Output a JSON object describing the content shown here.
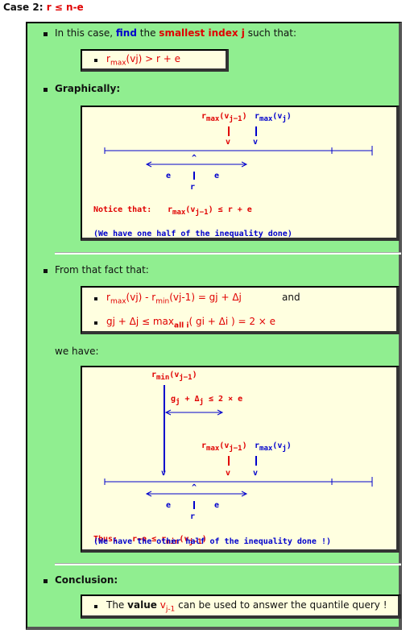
{
  "case_title": {
    "prefix": "Case 2:",
    "condition": "r ≤ n-e"
  },
  "section1": {
    "t1": "In this case,",
    "find": "find",
    "t2": "the",
    "smallest": "smallest index j",
    "t3": "such that:"
  },
  "formula1": {
    "r": "r",
    "max": "max",
    "arg": "(vj)",
    "rest": " > r + e"
  },
  "section2": {
    "title": "Graphically:"
  },
  "diagram1": {
    "rmax1": "r",
    "max1": "max",
    "arg1": "(v",
    "sub1": "j−1",
    "close1": ")",
    "rmax2": "r",
    "max2": "max",
    "arg2": "(v",
    "sub2": "j",
    "close2": ")",
    "v1": "v",
    "v2": "v",
    "e_left": "e",
    "e_right": "e",
    "r_label": "r",
    "caret": "^",
    "notice_label": "Notice that:",
    "notice_r": "r",
    "notice_max": "max",
    "notice_arg": "(v",
    "notice_sub": "j−1",
    "notice_rest": ") ≤ r + e",
    "half": "(We have one half of the inequality done)"
  },
  "section3": {
    "title": "From that fact that:"
  },
  "formula2": {
    "line1_r": "r",
    "line1_max": "max",
    "line1_arg": "(vj) - r",
    "line1_min": "min",
    "line1_arg2": "(vj-1) = gj + Δj",
    "and": "and",
    "line2_a": "gj + Δj ≤ max",
    "line2_sub": "all i",
    "line2_b": "( gi + Δi ) = 2 × e"
  },
  "we_have": "we have:",
  "diagram2": {
    "rmin": "r",
    "min": "min",
    "rmin_arg": "(v",
    "rmin_sub": "j−1",
    "rmin_close": ")",
    "gap": "g",
    "gap_sub": "j",
    "gap_plus": " + Δ",
    "gap_sub2": "j",
    "gap_rest": " ≤ 2 × e",
    "rmax1": "r",
    "max1": "max",
    "arg1": "(v",
    "sub1": "j−1",
    "close1": ")",
    "rmax2": "r",
    "max2": "max",
    "arg2": "(v",
    "sub2": "j",
    "close2": ")",
    "v0": "v",
    "v1": "v",
    "v2": "v",
    "e_left": "e",
    "e_right": "e",
    "r_label": "r",
    "caret": "^",
    "thus_label": "Thus:",
    "thus_expr": "r−e ≤ r",
    "thus_min": "min",
    "thus_arg": "(v",
    "thus_sub": "j−1",
    "thus_close": ")",
    "half": "(We have the other half of the inequality done !)"
  },
  "section4": {
    "title": "Conclusion:"
  },
  "conclusion": {
    "t1": "The",
    "value": "value",
    "v": "v",
    "vsub": "j-1",
    "t2": "can be used to answer the quantile query !"
  },
  "colors": {
    "red": "#e00000",
    "blue": "#0000cc",
    "green": "#90ee90",
    "cream": "#ffffe0"
  }
}
